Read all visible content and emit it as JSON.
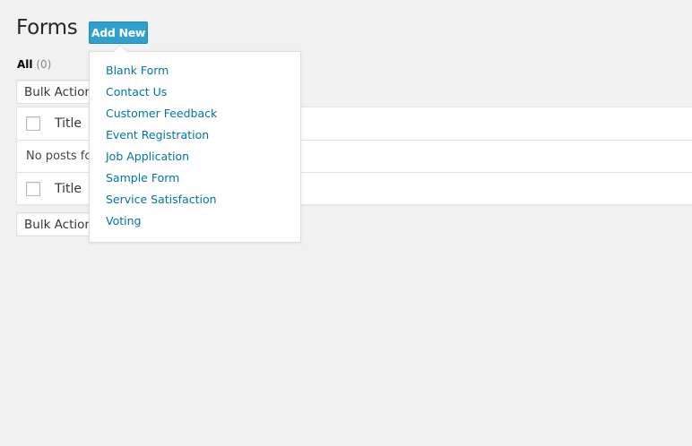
{
  "header": {
    "title": "Forms",
    "add_new_label": "Add New"
  },
  "filters": {
    "all_label": "All",
    "all_count": "(0)"
  },
  "bulk_actions": {
    "top_label": "Bulk Actions",
    "bottom_label": "Bulk Actions"
  },
  "table": {
    "header_title": "Title",
    "footer_title": "Title",
    "empty_message": "No posts found."
  },
  "add_new_menu": {
    "items": [
      "Blank Form",
      "Contact Us",
      "Customer Feedback",
      "Event Registration",
      "Job Application",
      "Sample Form",
      "Service Satisfaction",
      "Voting"
    ]
  },
  "colors": {
    "accent": "#2ea2cc",
    "link": "#0073aa",
    "background": "#f1f1f1"
  }
}
